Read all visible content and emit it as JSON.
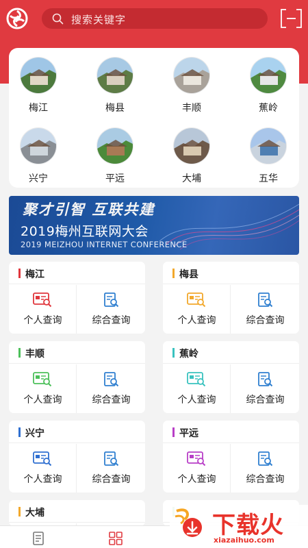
{
  "header": {
    "search_placeholder": "搜索关键字"
  },
  "cities": [
    {
      "name": "梅江"
    },
    {
      "name": "梅县"
    },
    {
      "name": "丰顺"
    },
    {
      "name": "蕉岭"
    },
    {
      "name": "兴宁"
    },
    {
      "name": "平远"
    },
    {
      "name": "大埔"
    },
    {
      "name": "五华"
    }
  ],
  "banner": {
    "slogan": "聚才引智  互联共建",
    "title": "2019梅州互联网大会",
    "subtitle": "2019 MEIZHOU INTERNET CONFERENCE"
  },
  "query": {
    "personal_label": "个人查询",
    "general_label": "综合查询"
  },
  "cards": [
    {
      "name": "梅江",
      "color": "#e0363c"
    },
    {
      "name": "梅县",
      "color": "#f2a82b"
    },
    {
      "name": "丰顺",
      "color": "#4cc05a"
    },
    {
      "name": "蕉岭",
      "color": "#39c2bf"
    },
    {
      "name": "兴宁",
      "color": "#2f6fd0"
    },
    {
      "name": "平远",
      "color": "#b83ec7"
    },
    {
      "name": "大埔",
      "color": "#f2a82b"
    },
    {
      "name": "",
      "color": "#4cc05a"
    }
  ],
  "colors": {
    "brand_red": "#e03a40",
    "general_icon_blue": "#2f7fd0"
  },
  "watermark": {
    "text": "下载火",
    "url": "xiazaihuo.com"
  },
  "tabbar": {
    "icons": [
      "document-icon",
      "grid-icon"
    ]
  }
}
